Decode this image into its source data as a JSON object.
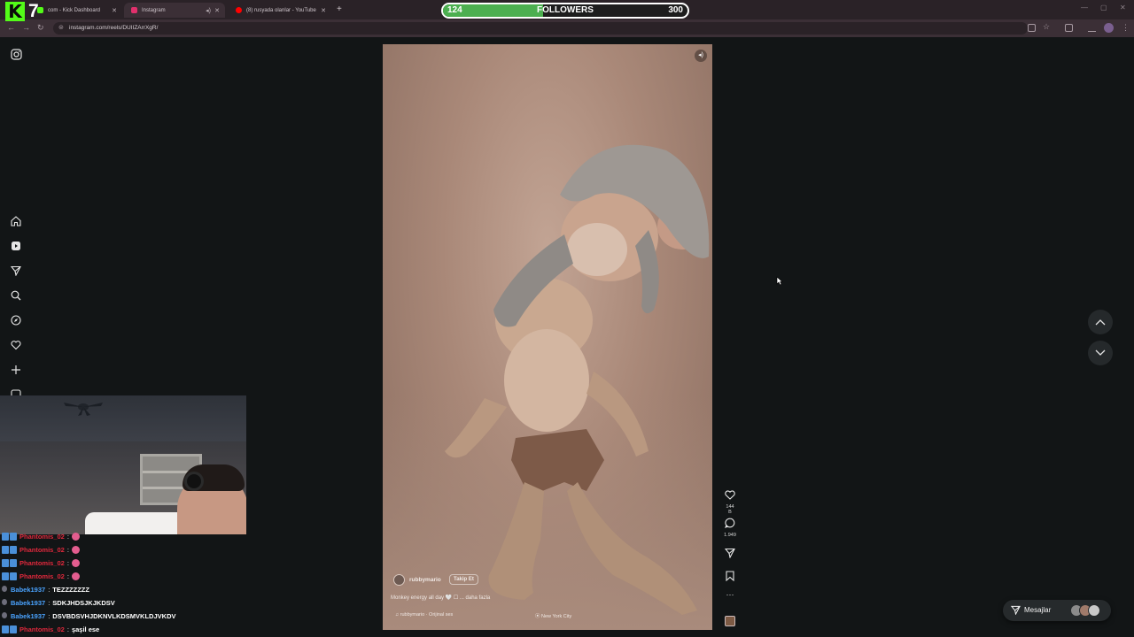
{
  "browser": {
    "tabs": [
      {
        "title": "com - Kick Dashboard",
        "favicon_color": "#53fc18"
      },
      {
        "title": "Instagram",
        "favicon_color": "#e1306c"
      },
      {
        "title": "(8) rusyada olanlar - YouTube",
        "favicon_color": "#ff0000"
      }
    ],
    "url": "instagram.com/reels/DUIIZArrXgR/"
  },
  "overlay": {
    "kick_logo": "K",
    "kick_number": "7",
    "followers": {
      "current": "124",
      "label": "FOLLOWERS",
      "goal": "300",
      "progress": 0.41,
      "color": "#4caf50"
    }
  },
  "reel": {
    "username": "rubbymario",
    "follow_label": "Takip Et",
    "caption": "Monkey energy all day 🤍 ☐ ... daha fazla",
    "audio": "rubbymario · Orijinal ses",
    "location": "New York City",
    "likes": "144 B",
    "comments": "1.949"
  },
  "messages": {
    "label": "Mesajlar"
  },
  "chat": [
    {
      "user": "Phantomis_02",
      "color": "#e0283c",
      "message": "",
      "emoji": true,
      "badges": "double"
    },
    {
      "user": "Phantomis_02",
      "color": "#e0283c",
      "message": "",
      "emoji": true,
      "badges": "double"
    },
    {
      "user": "Phantomis_02",
      "color": "#e0283c",
      "message": "",
      "emoji": true,
      "badges": "double"
    },
    {
      "user": "Phantomis_02",
      "color": "#e0283c",
      "message": "",
      "emoji": true,
      "badges": "double"
    },
    {
      "user": "Babek1937",
      "color": "#4aa3ff",
      "message": "TEZZZZZZZ",
      "emoji": false,
      "badges": "single"
    },
    {
      "user": "Babek1937",
      "color": "#4aa3ff",
      "message": "SDKJHDSJKJKDSV",
      "emoji": false,
      "badges": "single"
    },
    {
      "user": "Babek1937",
      "color": "#4aa3ff",
      "message": "DSVBDSVHJDKNVLKDSMVKLDJVKDV",
      "emoji": false,
      "badges": "single"
    },
    {
      "user": "Phantomis_02",
      "color": "#e0283c",
      "message": "şaşil ese",
      "emoji": false,
      "badges": "double"
    }
  ],
  "sidebar_icons": [
    "instagram-icon",
    "home-icon",
    "reels-icon",
    "direct-icon",
    "search-icon",
    "explore-icon",
    "heart-icon",
    "create-icon",
    "more-icon"
  ]
}
